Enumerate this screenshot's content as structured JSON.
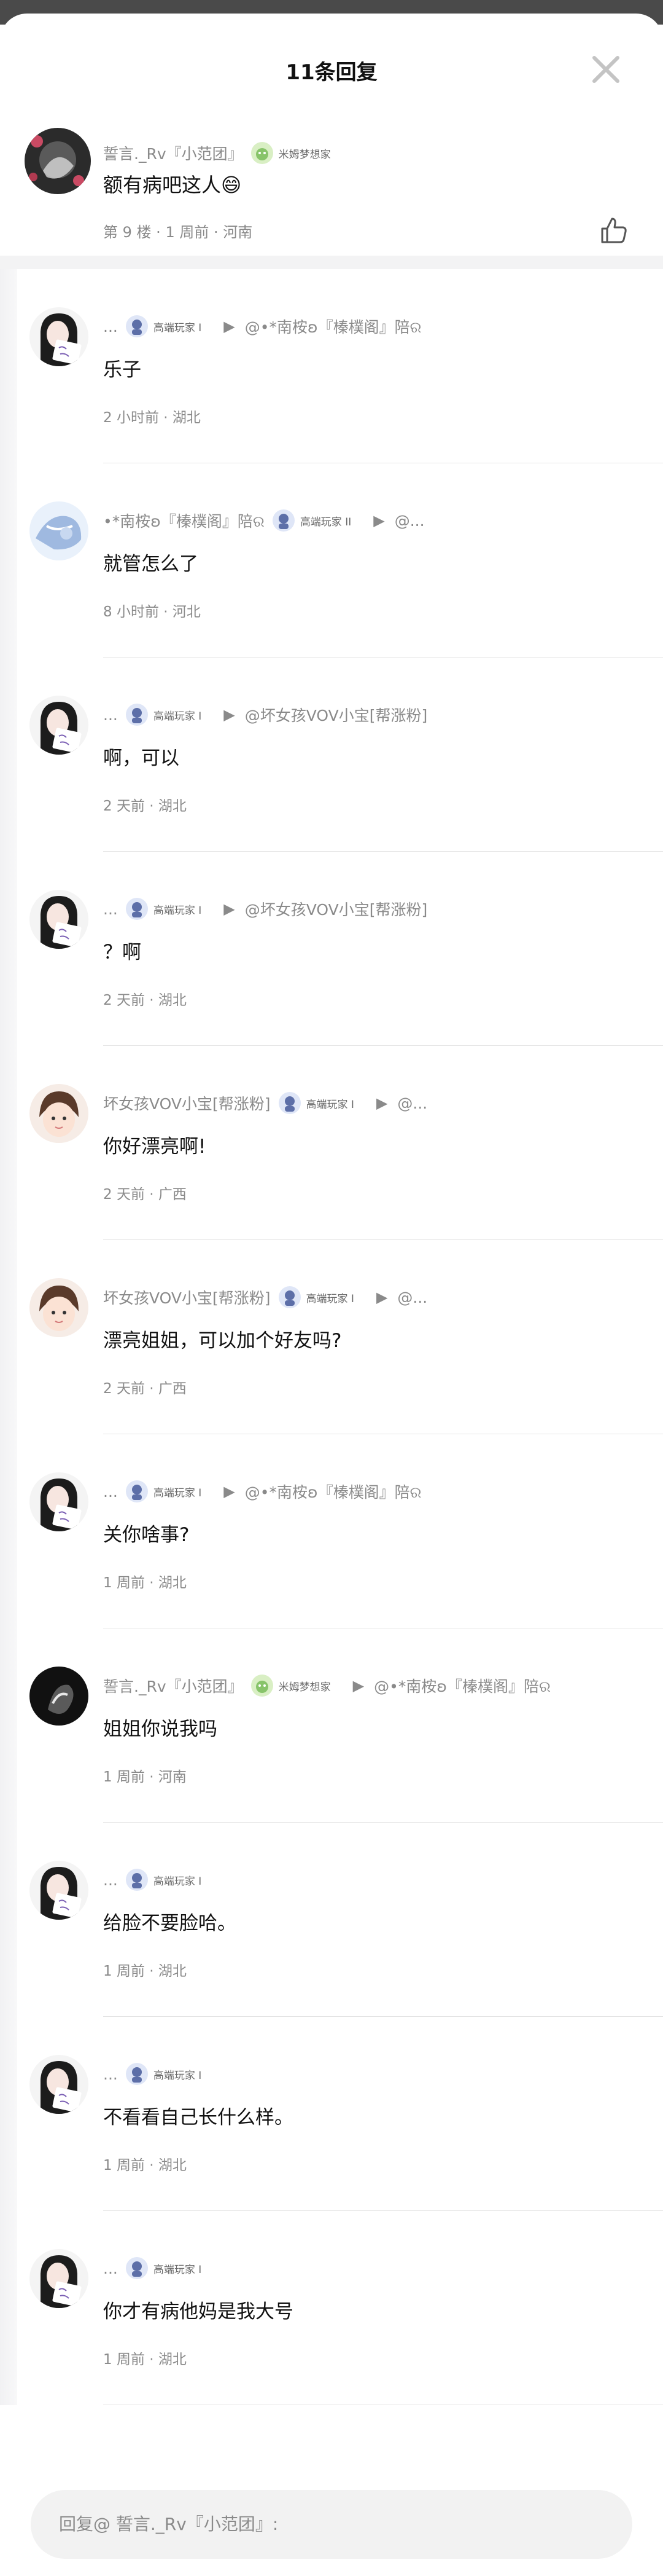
{
  "header": {
    "title": "11条回复"
  },
  "root_comment": {
    "username": "誓言._Rv『小范团』",
    "badge": "米姆梦想家",
    "text": "额有病吧这人😄",
    "floor": "第 9 楼",
    "time": "1 周前",
    "location": "河南"
  },
  "replies": [
    {
      "avatar": "girl-sign",
      "username": "...",
      "badge": "高端玩家 I",
      "target": "@•*南桉ʚ『榛樸阁』陪ର",
      "text": "乐子",
      "time": "2 小时前",
      "location": "湖北"
    },
    {
      "avatar": "blue-anime",
      "username": "•*南桉ʚ『榛樸阁』陪ର",
      "badge": "高端玩家 II",
      "target": "@...",
      "text": "就管怎么了",
      "time": "8 小时前",
      "location": "河北"
    },
    {
      "avatar": "girl-sign",
      "username": "...",
      "badge": "高端玩家 I",
      "target": "@坏女孩VOV小宝[帮涨粉]",
      "text": "啊，可以",
      "time": "2 天前",
      "location": "湖北"
    },
    {
      "avatar": "girl-sign",
      "username": "...",
      "badge": "高端玩家 I",
      "target": "@坏女孩VOV小宝[帮涨粉]",
      "text": "？啊",
      "time": "2 天前",
      "location": "湖北"
    },
    {
      "avatar": "baby-face",
      "username": "坏女孩VOV小宝[帮涨粉]",
      "badge": "高端玩家 I",
      "target": "@...",
      "text": "你好漂亮啊!",
      "time": "2 天前",
      "location": "广西"
    },
    {
      "avatar": "baby-face",
      "username": "坏女孩VOV小宝[帮涨粉]",
      "badge": "高端玩家 I",
      "target": "@...",
      "text": "漂亮姐姐，可以加个好友吗?",
      "time": "2 天前",
      "location": "广西"
    },
    {
      "avatar": "girl-sign",
      "username": "...",
      "badge": "高端玩家 I",
      "target": "@•*南桉ʚ『榛樸阁』陪ର",
      "text": "关你啥事?",
      "time": "1 周前",
      "location": "湖北"
    },
    {
      "avatar": "dark-swirl",
      "username": "誓言._Rv『小范团』",
      "badge": "米姆梦想家",
      "target": "@•*南桉ʚ『榛樸阁』陪ର",
      "text": "姐姐你说我吗",
      "time": "1 周前",
      "location": "河南"
    },
    {
      "avatar": "girl-sign",
      "username": "...",
      "badge": "高端玩家 I",
      "target": "",
      "text": "给脸不要脸哈。",
      "time": "1 周前",
      "location": "湖北"
    },
    {
      "avatar": "girl-sign",
      "username": "...",
      "badge": "高端玩家 I",
      "target": "",
      "text": "不看看自己长什么样。",
      "time": "1 周前",
      "location": "湖北"
    },
    {
      "avatar": "girl-sign",
      "username": "...",
      "badge": "高端玩家 I",
      "target": "",
      "text": "你才有病他妈是我大号",
      "time": "1 周前",
      "location": "湖北"
    }
  ],
  "input": {
    "placeholder": "回复@ 誓言._Rv『小范团』:"
  },
  "colors": {
    "text_primary": "#111111",
    "text_secondary": "#8a8a8a",
    "divider": "#e4e4e4",
    "input_bg": "#f2f2f2"
  }
}
